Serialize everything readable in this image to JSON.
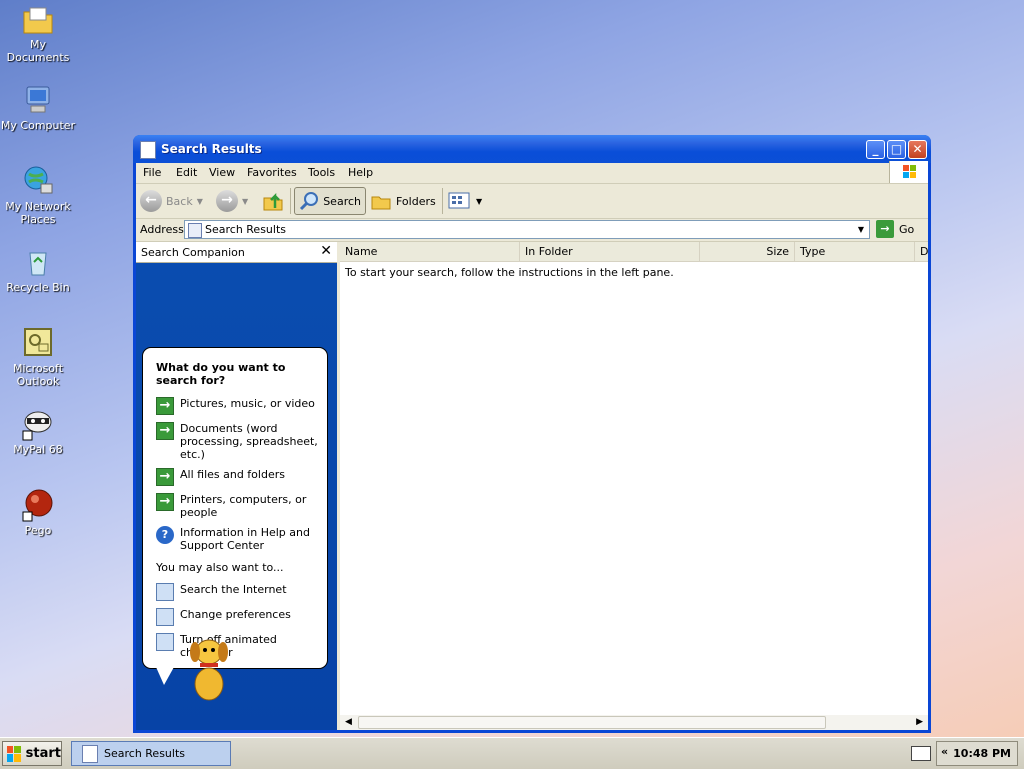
{
  "desktop": {
    "icons": [
      {
        "label": "My Documents"
      },
      {
        "label": "My Computer"
      },
      {
        "label": "My Network Places"
      },
      {
        "label": "Recycle Bin"
      },
      {
        "label": "Microsoft Outlook"
      },
      {
        "label": "MyPal 68"
      },
      {
        "label": "Pego"
      }
    ]
  },
  "window": {
    "title": "Search Results",
    "menu": [
      "File",
      "Edit",
      "View",
      "Favorites",
      "Tools",
      "Help"
    ],
    "toolbar": {
      "back": "Back",
      "search": "Search",
      "folders": "Folders"
    },
    "address": {
      "label": "Address",
      "value": "Search Results",
      "go": "Go"
    }
  },
  "search_pane": {
    "title": "Search Companion",
    "close": "✕",
    "heading": "What do you want to search for?",
    "options": [
      "Pictures, music, or video",
      "Documents (word processing, spreadsheet, etc.)",
      "All files and folders",
      "Printers, computers, or people",
      "Information in Help and Support Center"
    ],
    "also_label": "You may also want to...",
    "also_options": [
      "Search the Internet",
      "Change preferences",
      "Turn off animated character"
    ]
  },
  "results": {
    "columns": [
      "Name",
      "In Folder",
      "Size",
      "Type",
      "D"
    ],
    "message": "To start your search, follow the instructions in the left pane."
  },
  "taskbar": {
    "start": "start",
    "task": "Search Results",
    "time": "10:48 PM",
    "chevron": "«"
  }
}
